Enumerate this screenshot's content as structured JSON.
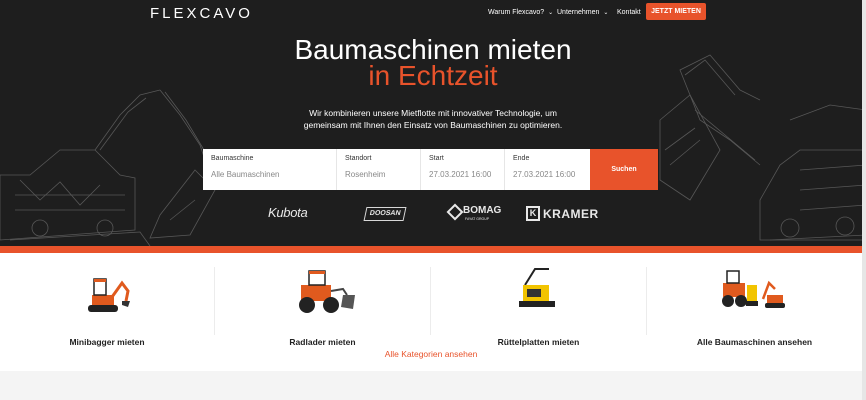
{
  "header": {
    "logo": "FLEXCAVO",
    "nav": [
      {
        "label": "Warum Flexcavo?"
      },
      {
        "label": "Unternehmen"
      },
      {
        "label": "Kontakt"
      }
    ],
    "cta_label": "JETZT MIETEN"
  },
  "hero": {
    "title_line1": "Baumaschinen mieten",
    "title_line2": "in Echtzeit",
    "subtitle_line1": "Wir kombinieren unsere Mietflotte mit innovativer Technologie, um",
    "subtitle_line2": "gemeinsam mit Ihnen den Einsatz von Baumaschinen zu optimieren."
  },
  "search": {
    "fields": [
      {
        "label": "Baumaschine",
        "value": "Alle Baumaschinen"
      },
      {
        "label": "Standort",
        "value": "Rosenheim"
      },
      {
        "label": "Start",
        "value": "27.03.2021 16:00"
      },
      {
        "label": "Ende",
        "value": "27.03.2021 16:00"
      }
    ],
    "button_label": "Suchen"
  },
  "brands": {
    "kubota": "Kubota",
    "doosan": "DOOSAN",
    "bomag": "BOMAG",
    "bomag_sub": "FAYAT GROUP",
    "kramer_mark": "K",
    "kramer": "KRAMER"
  },
  "categories": [
    {
      "label": "Minibagger mieten",
      "icon": "mini-excavator"
    },
    {
      "label": "Radlader mieten",
      "icon": "wheel-loader"
    },
    {
      "label": "Rüttelplatten mieten",
      "icon": "vibratory-plate"
    },
    {
      "label": "Alle Baumaschinen ansehen",
      "icon": "all-machines"
    }
  ],
  "all_categories_link": "Alle Kategorien ansehen",
  "colors": {
    "accent": "#e8532b",
    "hero_bg": "#1e1e1e",
    "machine_orange": "#e05a1e"
  }
}
